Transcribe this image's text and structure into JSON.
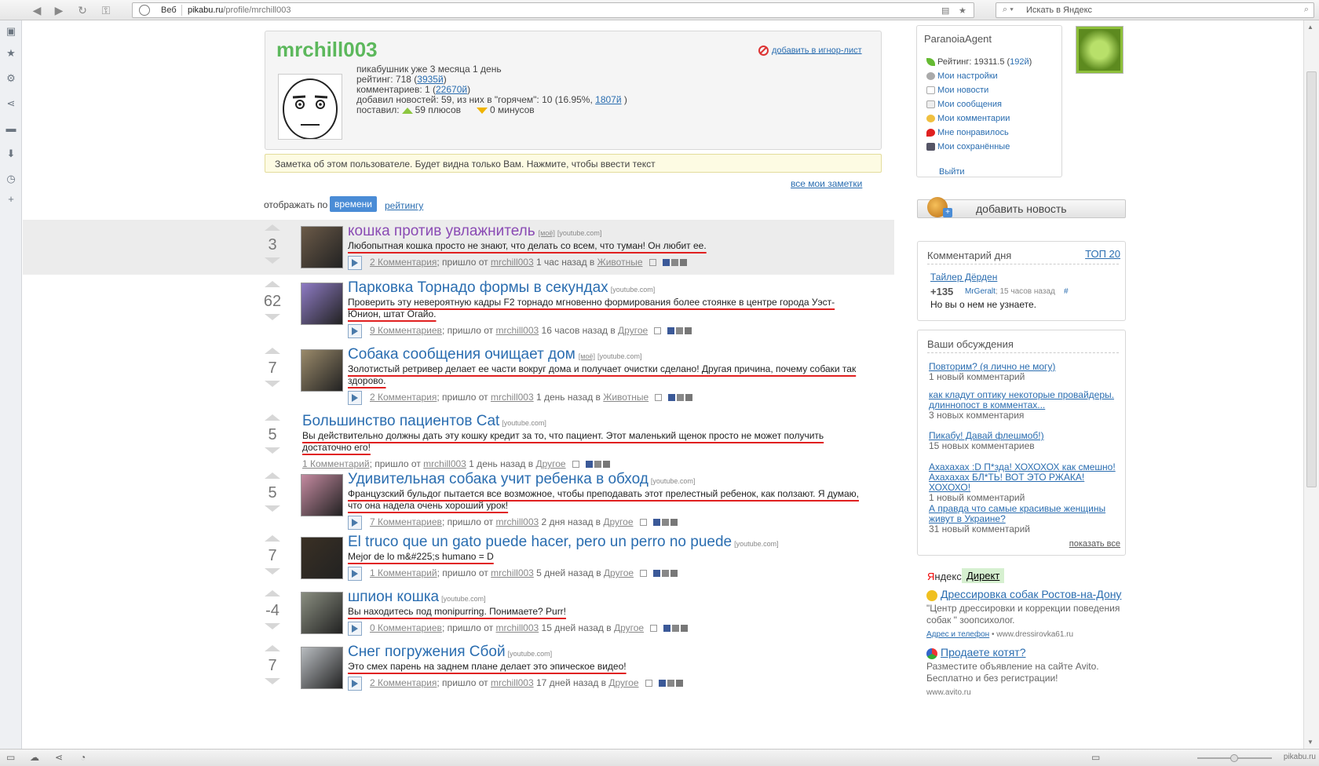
{
  "browser": {
    "web_label": "Веб",
    "url_host": "pikabu.ru",
    "url_path": "/profile/mrchill003",
    "search_placeholder": "Искать в Яндекс"
  },
  "profile": {
    "username": "mrchill003",
    "ignore_label": "добавить в игнор-лист",
    "line1": "пикабушник уже 3 месяца 1 день",
    "rating_prefix": "рейтинг: 718 (",
    "rating_rank": "3935й",
    "rating_suffix": ")",
    "comments_prefix": "комментариев: 1 (",
    "comments_rank": "22670й",
    "comments_suffix": ")",
    "news_prefix": "добавил новостей: 59, из них в \"горячем\": 10 (16.95%, ",
    "news_rank": "1807й",
    "news_suffix": " )",
    "votes_prefix": "поставил:",
    "plus": "59 плюсов",
    "minus": "0 минусов"
  },
  "note": "Заметка об этом пользователе. Будет видна только Вам. Нажмите, чтобы ввести текст",
  "all_notes": "все мои заметки",
  "sort": {
    "label": "отображать по",
    "active": "времени",
    "other": "рейтингу"
  },
  "stories": [
    {
      "votes": "3",
      "title": "кошка против увлажнитель",
      "tag": "[моё]",
      "src": "[youtube.com]",
      "desc": "Любопытная кошка просто не знают, что делать со всем, что туман! Он любит ее.",
      "comments": "2 Комментария",
      "author": "mrchill003",
      "time": " 1 час назад в ",
      "category": "Животные",
      "thumb_color": "#6b5a48"
    },
    {
      "votes": "62",
      "title": "Парковка Торнадо формы в секундах",
      "tag": "",
      "src": "[youtube.com]",
      "desc": "Проверить эту невероятную кадры F2 торнадо мгновенно формирования более стоянке в центре города Уэст-Юнион, штат Огайо.",
      "comments": "9 Комментариев",
      "author": "mrchill003",
      "time": " 16 часов назад в ",
      "category": "Другое",
      "thumb_color": "#8e7bc4"
    },
    {
      "votes": "7",
      "title": "Собака сообщения очищает дом",
      "tag": "[моё]",
      "src": "[youtube.com]",
      "desc": "Золотистый ретривер делает ее части вокруг дома и получает очистки сделано! Другая причина, почему собаки так здорово.",
      "comments": "2 Комментария",
      "author": "mrchill003",
      "time": " 1 день назад в ",
      "category": "Животные",
      "thumb_color": "#9a8a6a"
    },
    {
      "votes": "5",
      "title": "Большинство пациентов Cat",
      "tag": "",
      "src": "[youtube.com]",
      "desc": "Вы действительно должны дать эту кошку кредит за то, что пациент. Этот маленький щенок просто не может получить достаточно его!",
      "comments": "1 Комментарий",
      "author": "mrchill003",
      "time": " 1 день назад в ",
      "category": "Другое",
      "thumb_color": ""
    },
    {
      "votes": "5",
      "title": "Удивительная собака учит ребенка в обход",
      "tag": "",
      "src": "[youtube.com]",
      "desc": "Французский бульдог пытается все возможное, чтобы преподавать этот прелестный ребенок, как ползают. Я думаю, что она надела очень хороший урок!",
      "comments": "7 Комментариев",
      "author": "mrchill003",
      "time": " 2 дня назад в ",
      "category": "Другое",
      "thumb_color": "#c48aa0"
    },
    {
      "votes": "7",
      "title": "El truco que un gato puede hacer, pero un perro no puede",
      "tag": "",
      "src": "[youtube.com]",
      "desc": "Mejor de lo m&#225;s humano = D",
      "comments": "1 Комментарий",
      "author": "mrchill003",
      "time": " 5 дней назад в ",
      "category": "Другое",
      "thumb_color": "#3a3024"
    },
    {
      "votes": "-4",
      "title": "шпион кошка",
      "tag": "",
      "src": "[youtube.com]",
      "desc": "Вы находитесь под monipurring. Понимаете? Purr!",
      "comments": "0 Комментариев",
      "author": "mrchill003",
      "time": " 15 дней назад в ",
      "category": "Другое",
      "thumb_color": "#8a8e80"
    },
    {
      "votes": "7",
      "title": "Снег погружения Сбой",
      "tag": "",
      "src": "[youtube.com]",
      "desc": "Это смех парень на заднем плане делает это эпическое видео!",
      "comments": "2 Комментария",
      "author": "mrchill003",
      "time": " 17 дней назад в ",
      "category": "Другое",
      "thumb_color": "#b8bcc0"
    }
  ],
  "userbox": {
    "name": "ParanoiaAgent",
    "rating_prefix": "Рейтинг: 19311.5 (",
    "rating_rank": "192й",
    "rating_suffix": ")",
    "items": [
      "Мои настройки",
      "Мои новости",
      "Мои сообщения",
      "Мои комментарии",
      "Мне понравилось",
      "Мои сохранённые"
    ],
    "logout": "Выйти"
  },
  "add_news": "добавить новость",
  "comment_of_day": {
    "title": "Комментарий дня",
    "top": "ТОП 20",
    "author": "Тайлер Дёрден",
    "score": "+135",
    "by": "MrGeralt",
    "when": "; 15 часов назад",
    "hash": "#",
    "text": "Но вы о нем не узнаете."
  },
  "discussions": {
    "title": "Ваши обсуждения",
    "items": [
      {
        "link": "Повторим? (я лично не могу)",
        "count": "1 новый комментарий"
      },
      {
        "link": "как кладут оптику некоторые провайдеры. длиннопост в комментах...",
        "count": "3 новых комментария"
      },
      {
        "link": "Пикабу! Давай флешмоб!)",
        "count": "15 новых комментариев"
      },
      {
        "link": "Ахахахах :D П*зда! ХОХОХОХ как смешно! Ахахахах БЛ*ТЬ! ВОТ ЭТО РЖАКА! ХОХОХО!",
        "count": "1 новый комментарий"
      },
      {
        "link": "А правда что самые красивые женщины живут в Украине?",
        "count": "31 новый комментарий"
      }
    ],
    "show_all": "показать все"
  },
  "direct": {
    "logo_y": "Я",
    "logo_rest": "ндекс",
    "label": "Директ",
    "ads": [
      {
        "title": "Дрессировка собак Ростов-на-Дону",
        "text": "\"Центр дрессировки и коррекции поведения собак \" зоопсихолог.",
        "link_label": "Адрес и телефон",
        "link_url": " • www.dressirovka61.ru"
      },
      {
        "title": "Продаете котят?",
        "text": "Разместите объявление на сайте Avito. Бесплатно и без регистрации!",
        "link_label": "",
        "link_url": "www.avito.ru"
      }
    ]
  },
  "watermark": "pikabu.ru",
  "colors": {
    "accent": "#2a6db0",
    "username": "#5cb85c",
    "sort_active": "#4a8cd6",
    "note_bg": "#fdfbe3",
    "highlight": "#ececec",
    "underline": "#e02020"
  }
}
